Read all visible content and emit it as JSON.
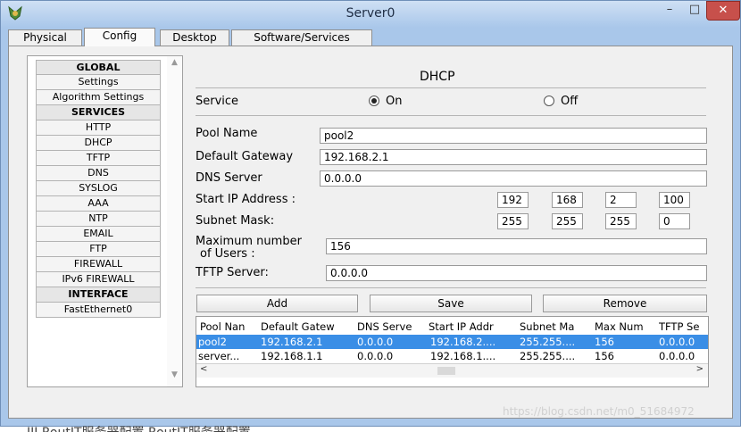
{
  "window": {
    "title": "Server0",
    "min_glyph": "–",
    "max_glyph": "□",
    "close_glyph": "✕"
  },
  "tabs": [
    {
      "label": "Physical"
    },
    {
      "label": "Config",
      "active": true
    },
    {
      "label": "Desktop"
    },
    {
      "label": "Software/Services"
    }
  ],
  "sidebar": {
    "items": [
      {
        "label": "GLOBAL",
        "header": true
      },
      {
        "label": "Settings"
      },
      {
        "label": "Algorithm Settings"
      },
      {
        "label": "SERVICES",
        "header": true
      },
      {
        "label": "HTTP"
      },
      {
        "label": "DHCP"
      },
      {
        "label": "TFTP"
      },
      {
        "label": "DNS"
      },
      {
        "label": "SYSLOG"
      },
      {
        "label": "AAA"
      },
      {
        "label": "NTP"
      },
      {
        "label": "EMAIL"
      },
      {
        "label": "FTP"
      },
      {
        "label": "FIREWALL"
      },
      {
        "label": "IPv6 FIREWALL"
      },
      {
        "label": "INTERFACE",
        "header": true
      },
      {
        "label": "FastEthernet0"
      }
    ]
  },
  "dhcp": {
    "title": "DHCP",
    "service_label": "Service",
    "on_label": "On",
    "off_label": "Off",
    "service_state": "On",
    "pool_name_label": "Pool Name",
    "pool_name": "pool2",
    "gateway_label": "Default Gateway",
    "gateway": "192.168.2.1",
    "dns_label": "DNS Server",
    "dns": "0.0.0.0",
    "start_ip_label": "Start IP Address :",
    "start_ip": [
      "192",
      "168",
      "2",
      "100"
    ],
    "mask_label": "Subnet Mask:",
    "mask": [
      "255",
      "255",
      "255",
      "0"
    ],
    "max_users_label_1": "Maximum number",
    "max_users_label_2": "of Users :",
    "max_users": "156",
    "tftp_label": "TFTP Server:",
    "tftp": "0.0.0.0",
    "add_label": "Add",
    "save_label": "Save",
    "remove_label": "Remove"
  },
  "pool_table": {
    "headers": [
      "Pool Nan",
      "Default Gatew",
      "DNS Serve",
      "Start IP Addr",
      "Subnet Ma",
      "Max Num",
      "TFTP Se"
    ],
    "rows": [
      [
        "pool2",
        "192.168.2.1",
        "0.0.0.0",
        "192.168.2....",
        "255.255....",
        "156",
        "0.0.0.0"
      ],
      [
        "server...",
        "192.168.1.1",
        "0.0.0.0",
        "192.168.1....",
        "255.255....",
        "156",
        "0.0.0.0"
      ]
    ],
    "selected_row": 0,
    "scroll_left": "<",
    "scroll_right": ">"
  },
  "watermark": "https://blog.csdn.net/m0_51684972",
  "behind_text": "III      RoutIT服务器配置 RoutIT服务器配置"
}
